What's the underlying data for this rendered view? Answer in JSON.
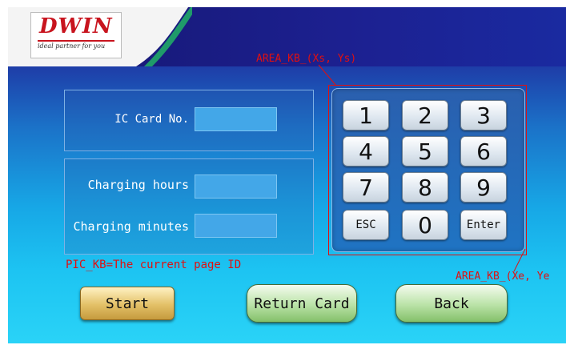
{
  "header": {
    "logo_text": "DWIN",
    "logo_tagline": "ideal partner for you"
  },
  "annotations": {
    "area_start": "AREA_KB_(Xs, Ys)",
    "area_end": "AREA_KB_(Xe, Ye",
    "pic_kb": "PIC_KB=The current page ID"
  },
  "form": {
    "ic_card_label": "IC Card No.",
    "ic_card_value": "",
    "charging_hours_label": "Charging hours",
    "charging_hours_value": "",
    "charging_minutes_label": "Charging minutes",
    "charging_minutes_value": ""
  },
  "keypad": {
    "keys": [
      "1",
      "2",
      "3",
      "4",
      "5",
      "6",
      "7",
      "8",
      "9",
      "ESC",
      "0",
      "Enter"
    ]
  },
  "buttons": {
    "start": "Start",
    "return_card": "Return Card",
    "back": "Back"
  },
  "colors": {
    "annotation": "#e01010",
    "start_button": "#e3c067",
    "green_button": "#b9e2a6"
  }
}
